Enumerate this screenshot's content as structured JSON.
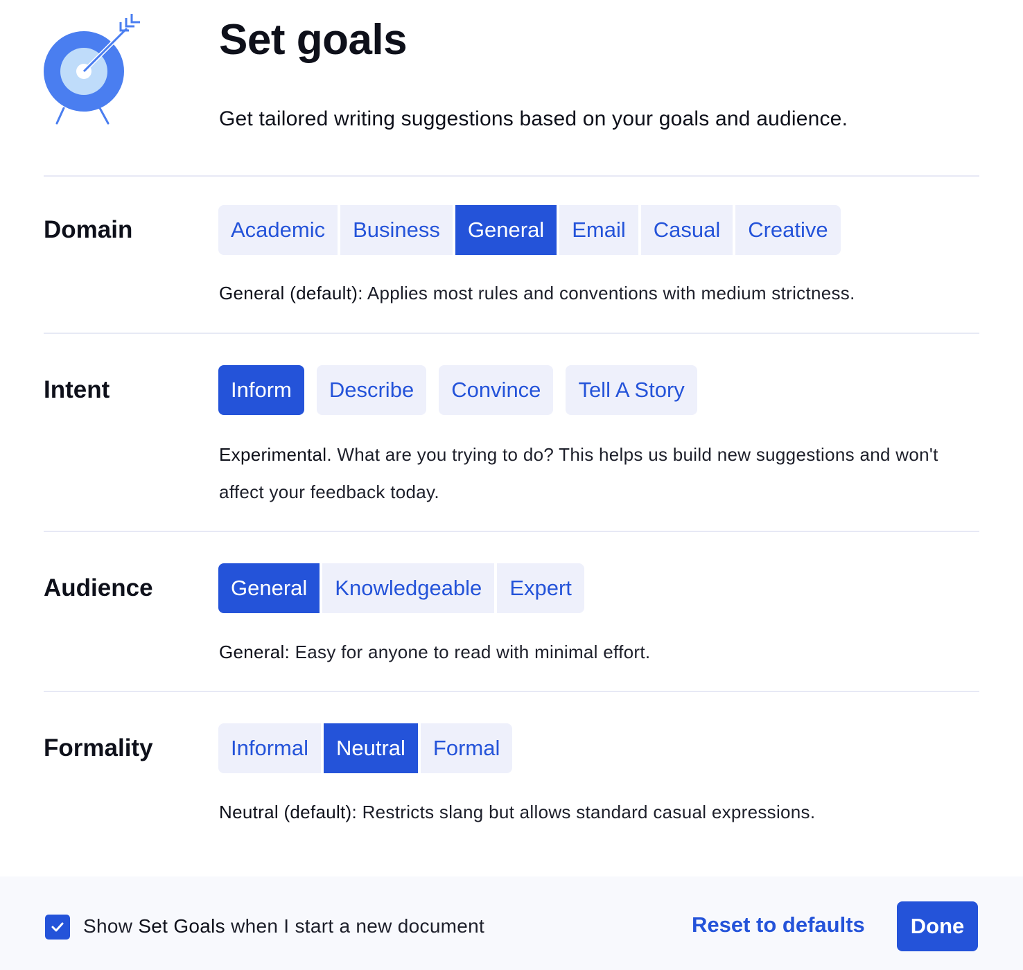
{
  "header": {
    "title": "Set goals",
    "subtitle": "Get tailored writing suggestions based on your goals and audience.",
    "icon": "target-with-arrow-icon"
  },
  "colors": {
    "accent": "#2453d9",
    "option_bg": "#eef0fb",
    "divider": "#e7e9f5",
    "footer_bg": "#f8f9fd",
    "text": "#0e101a",
    "logo_outer": "#4a7ef0",
    "logo_inner": "#bfdcfa"
  },
  "sections": {
    "domain": {
      "label": "Domain",
      "options": [
        "Academic",
        "Business",
        "General",
        "Email",
        "Casual",
        "Creative"
      ],
      "selected": "General",
      "description_lead": "General (default):",
      "description": " Applies most rules and conventions with medium strictness."
    },
    "intent": {
      "label": "Intent",
      "options": [
        "Inform",
        "Describe",
        "Convince",
        "Tell A Story"
      ],
      "selected": "Inform",
      "description_lead": "Experimental.",
      "description": " What are you trying to do? This helps us build new suggestions and won't affect your feedback today."
    },
    "audience": {
      "label": "Audience",
      "options": [
        "General",
        "Knowledgeable",
        "Expert"
      ],
      "selected": "General",
      "description_lead": "General:",
      "description": " Easy for anyone to read with minimal effort."
    },
    "formality": {
      "label": "Formality",
      "options": [
        "Informal",
        "Neutral",
        "Formal"
      ],
      "selected": "Neutral",
      "description_lead": "Neutral (default):",
      "description": " Restricts slang but allows standard casual expressions."
    }
  },
  "footer": {
    "checkbox_checked": true,
    "checkbox_label_pre": "Show ",
    "checkbox_label_strong": "Set Goals",
    "checkbox_label_post": " when I start a new document",
    "reset_label": "Reset to defaults",
    "done_label": "Done"
  }
}
